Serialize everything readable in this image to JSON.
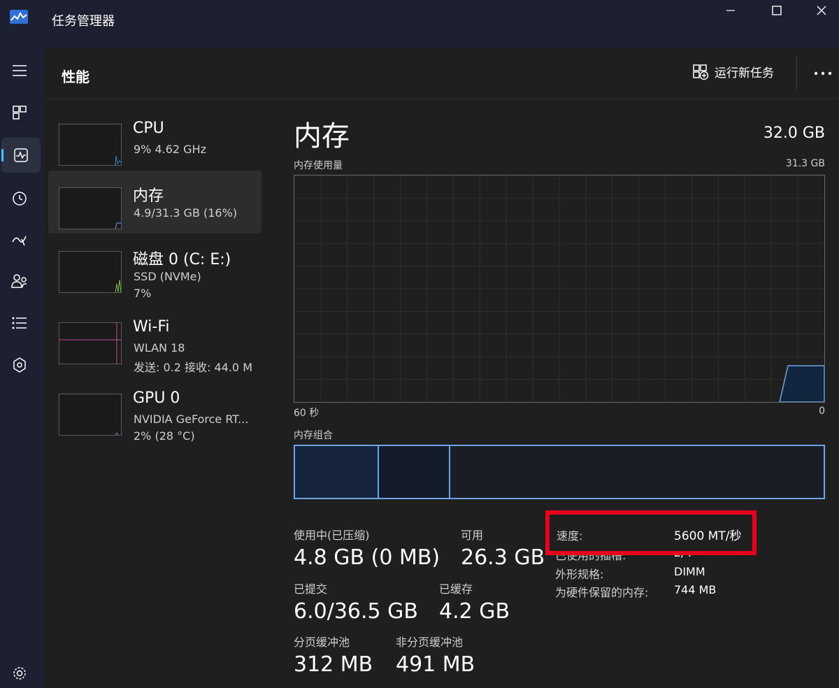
{
  "app": {
    "title": "任务管理器"
  },
  "header": {
    "page_title": "性能",
    "run_task_label": "运行新任务"
  },
  "devices": [
    {
      "name": "CPU",
      "line1": "9%  4.62 GHz",
      "line2": ""
    },
    {
      "name": "内存",
      "line1": "4.9/31.3 GB (16%)",
      "line2": ""
    },
    {
      "name": "磁盘 0 (C: E:)",
      "line1": "SSD (NVMe)",
      "line2": "7%"
    },
    {
      "name": "Wi-Fi",
      "line1": "WLAN 18",
      "line2": "发送: 0.2  接收: 44.0 M"
    },
    {
      "name": "GPU 0",
      "line1": "NVIDIA GeForce RT...",
      "line2": "2%  (28 °C)"
    }
  ],
  "detail": {
    "title": "内存",
    "total": "32.0 GB",
    "usage_label": "内存使用量",
    "usage_max": "31.3 GB",
    "axis_left": "60 秒",
    "axis_right": "0",
    "composition_label": "内存组合",
    "usage_fraction": 0.16
  },
  "stats": {
    "in_use_label": "使用中(已压缩)",
    "in_use_value": "4.8 GB (0 MB)",
    "available_label": "可用",
    "available_value": "26.3 GB",
    "committed_label": "已提交",
    "committed_value": "6.0/36.5 GB",
    "cached_label": "已缓存",
    "cached_value": "4.2 GB",
    "paged_label": "分页缓冲池",
    "paged_value": "312 MB",
    "nonpaged_label": "非分页缓冲池",
    "nonpaged_value": "491 MB"
  },
  "properties": {
    "speed_label": "速度:",
    "speed_value": "5600 MT/秒",
    "slots_label": "已使用的插槽:",
    "slots_value": "2/4",
    "form_label": "外形规格:",
    "form_value": "DIMM",
    "reserved_label": "为硬件保留的内存:",
    "reserved_value": "744 MB"
  },
  "colors": {
    "accent": "#4cc2ff",
    "memory_line": "#6ea3e6",
    "highlight_box": "#e8001c"
  }
}
